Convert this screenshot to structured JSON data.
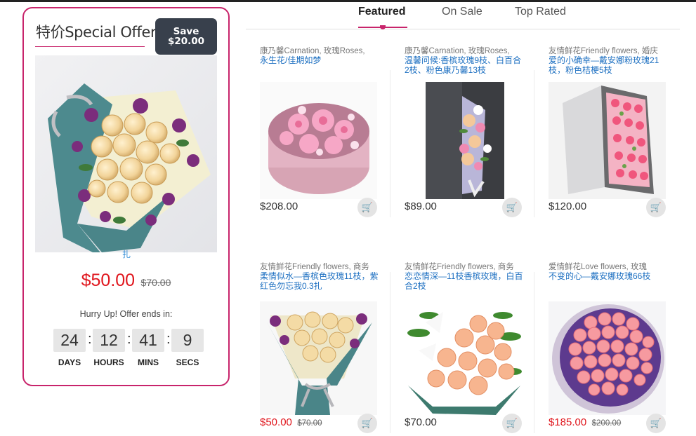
{
  "offer": {
    "title": "特价Special Offer",
    "save_line1": "Save",
    "save_line2": "$20.00",
    "hidden_link": "扎",
    "price": "$50.00",
    "old_price": "$70.00",
    "hurry_text": "Hurry Up! Offer ends in:",
    "timer": {
      "days": "24",
      "hours": "12",
      "mins": "41",
      "secs": "9",
      "days_label": "DAYS",
      "hours_label": "HOURS",
      "mins_label": "MINS",
      "secs_label": "SECS"
    }
  },
  "tabs": [
    {
      "label": "Featured",
      "active": true
    },
    {
      "label": "On Sale",
      "active": false
    },
    {
      "label": "Top Rated",
      "active": false
    }
  ],
  "products": [
    {
      "category": "康乃馨Carnation, 玫瑰Roses,",
      "name": "永生花/佳期如梦",
      "price": "$208.00",
      "old_price": "",
      "icon": "cart-icon"
    },
    {
      "category": "康乃馨Carnation, 玫瑰Roses,",
      "name": "温馨问候:香槟玫瑰9枝、白百合2枝、粉色康乃馨13枝",
      "price": "$89.00",
      "old_price": "",
      "icon": "cart-icon"
    },
    {
      "category": "友情鲜花Friendly flowers, 婚庆",
      "name": "爱的小确幸—戴安娜粉玫瑰21枝，粉色桔梗5枝",
      "price": "$120.00",
      "old_price": "",
      "icon": "cart-icon"
    },
    {
      "category": "友情鲜花Friendly flowers, 商务",
      "name": "柔情似水—香槟色玫瑰11枝，紫红色勿忘我0.3扎",
      "price": "$50.00",
      "old_price": "$70.00",
      "icon": "cart-icon"
    },
    {
      "category": "友情鲜花Friendly flowers, 商务",
      "name": "恋恋情深—11枝香槟玫瑰，白百合2枝",
      "price": "$70.00",
      "old_price": "",
      "icon": "cart-icon"
    },
    {
      "category": "爱情鲜花Love flowers, 玫瑰",
      "name": "不变的心—戴安娜玫瑰66枝",
      "price": "$185.00",
      "old_price": "$200.00",
      "icon": "cart-icon"
    }
  ],
  "colors": {
    "accent": "#c8246b",
    "sale_price": "#e0161d",
    "link": "#1c6fc1",
    "badge": "#38404c"
  }
}
